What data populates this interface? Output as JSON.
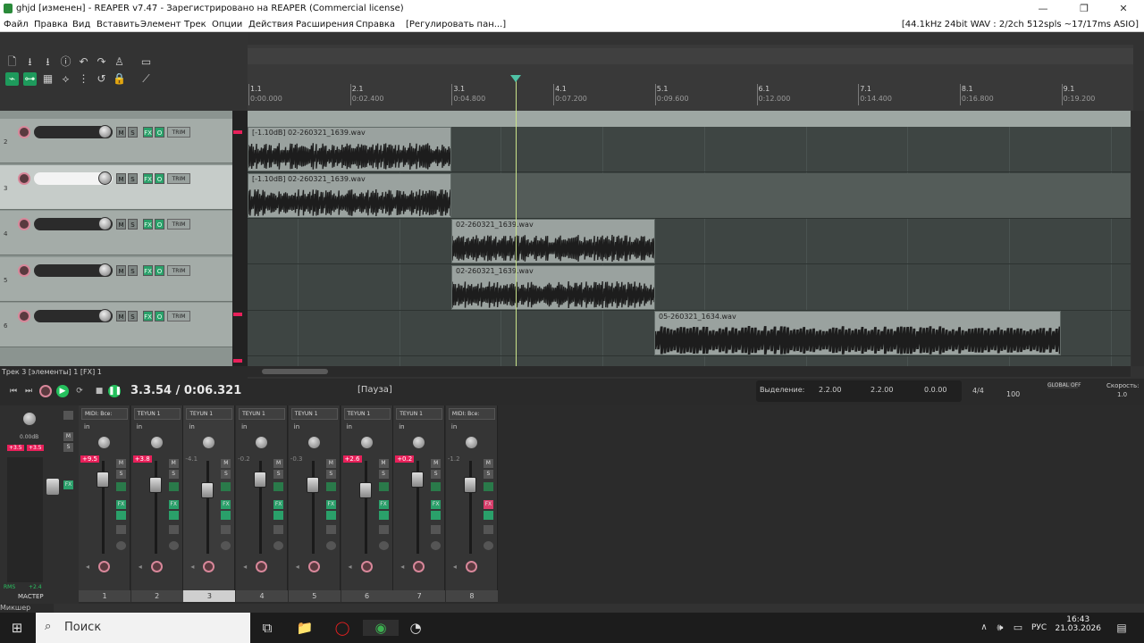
{
  "window": {
    "title": "ghjd [изменен] - REAPER v7.47 - Зарегистрировано на REAPER (Commercial license)",
    "min": "—",
    "max": "❐",
    "close": "✕"
  },
  "menu": {
    "items": [
      "Файл",
      "Правка",
      "Вид",
      "Вставить",
      "Элемент",
      "Трек",
      "Опции",
      "Действия",
      "Расширения",
      "Справка"
    ],
    "extra": "[Регулировать пан...]",
    "audio_info": "[44.1kHz 24bit WAV : 2/2ch 512spls ~17/17ms ASIO]"
  },
  "ruler": {
    "marks": [
      {
        "bar": "1.1",
        "time": "0:00.000"
      },
      {
        "bar": "2.1",
        "time": "0:02.400"
      },
      {
        "bar": "3.1",
        "time": "0:04.800"
      },
      {
        "bar": "4.1",
        "time": "0:07.200"
      },
      {
        "bar": "5.1",
        "time": "0:09.600"
      },
      {
        "bar": "6.1",
        "time": "0:12.000"
      },
      {
        "bar": "7.1",
        "time": "0:14.400"
      },
      {
        "bar": "8.1",
        "time": "0:16.800"
      },
      {
        "bar": "9.1",
        "time": "0:19.200"
      }
    ]
  },
  "tracks": [
    {
      "num": "2",
      "trim": "TRIM"
    },
    {
      "num": "3",
      "trim": "TRIM"
    },
    {
      "num": "4",
      "trim": "TRIM"
    },
    {
      "num": "5",
      "trim": "TRIM"
    },
    {
      "num": "6",
      "trim": "TRIM"
    }
  ],
  "track_buttons": {
    "m": "M",
    "s": "S",
    "fx": "FX",
    "io": "O"
  },
  "items": [
    {
      "lane": 0,
      "label": "[-1.10dB] 02-260321_1639.wav"
    },
    {
      "lane": 1,
      "label": "[-1.10dB] 02-260321_1639.wav"
    },
    {
      "lane": 2,
      "label": "02-260321_1639.wav"
    },
    {
      "lane": 3,
      "label": "02-260321_1639.wav"
    },
    {
      "lane": 4,
      "label": "05-260321_1634.wav"
    }
  ],
  "status_line": "Трек 3 [элементы] 1 [FX] 1",
  "transport": {
    "time": "3.3.54 / 0:06.321",
    "state": "[Пауза]",
    "sel_label": "Выделение:",
    "sel_start": "2.2.00",
    "sel_end": "2.2.00",
    "sel_len": "0.0.00",
    "sig": "4/4",
    "bpm": "100",
    "global": "GLOBAL OFF",
    "speed": "Скорость:",
    "speed_val": "1.0"
  },
  "master": {
    "label": "МАСТЕР",
    "vol": "0.00dB",
    "rms": "RMS",
    "rms_val": "+2.4",
    "peak_l": "+3.5",
    "peak_r": "+3.5",
    "title": "МИКШЕР"
  },
  "strips": [
    {
      "num": "1",
      "insert": "MIDI: Все:",
      "vol": "+9.5",
      "red": true,
      "fxred": false
    },
    {
      "num": "2",
      "insert": "TEYUN 1",
      "vol": "+3.8",
      "red": true,
      "fxred": false
    },
    {
      "num": "3",
      "insert": "TEYUN 1",
      "vol": "-4.1",
      "red": false,
      "fxred": false
    },
    {
      "num": "4",
      "insert": "TEYUN 1",
      "vol": "-0.2",
      "red": false,
      "fxred": false
    },
    {
      "num": "5",
      "insert": "TEYUN 1",
      "vol": "-0.3",
      "red": false,
      "fxred": false
    },
    {
      "num": "6",
      "insert": "TEYUN 1",
      "vol": "+2.6",
      "red": true,
      "fxred": false
    },
    {
      "num": "7",
      "insert": "TEYUN 1",
      "vol": "+0.2",
      "red": true,
      "fxred": false
    },
    {
      "num": "8",
      "insert": "MIDI: Все:",
      "vol": "-1.2",
      "red": false,
      "fxred": true
    }
  ],
  "strip_buttons": {
    "in": "in",
    "m": "M",
    "s": "S",
    "fx": "FX"
  },
  "mixer_tab": "Микшер",
  "taskbar": {
    "search": "Поиск",
    "lang": "РУС",
    "time": "16:43",
    "date": "21.03.2026"
  }
}
